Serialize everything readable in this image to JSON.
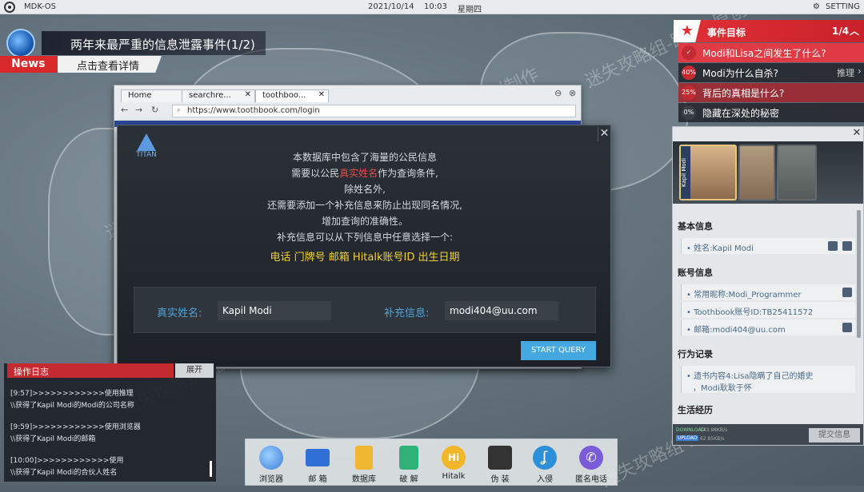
{
  "topbar": {
    "os_name": "MDK-OS",
    "date": "2021/10/14",
    "time": "10:03",
    "weekday": "星期四",
    "setting": "SETTING"
  },
  "news": {
    "title": "两年来最严重的信息泄露事件(1/2)",
    "label": "News",
    "subtitle": "点击查看详情"
  },
  "tasks": {
    "header": "事件目标",
    "count": "1/4",
    "items": [
      {
        "icon": "✓",
        "text": "Modi和Lisa之间发生了什么?",
        "highlight": true
      },
      {
        "icon": "40%",
        "text": "Modi为什么自杀?",
        "action": "推理"
      },
      {
        "icon": "25%",
        "text": "背后的真相是什么?",
        "highlight": false
      },
      {
        "icon": "0%",
        "text": "隐藏在深处的秘密"
      }
    ]
  },
  "info": {
    "portrait_name": "Kapil Modi",
    "sections": {
      "basic": "基本信息",
      "account": "账号信息",
      "behavior": "行为记录",
      "life": "生活经历"
    },
    "basic_items": [
      "姓名:Kapil Modi"
    ],
    "account_items": [
      "常用昵称:Modi_Programmer",
      "Toothbook账号ID:TB25411572",
      "邮箱:modi404@uu.com"
    ],
    "behavior_items": [
      "遗书内容4:Lisa隐瞒了自己的婚史",
      "，Modi耿耿于怀"
    ],
    "footer": {
      "download": "DOWNLOAD",
      "download_rate": "143.98KB/s",
      "upload": "UPLOAD",
      "upload_rate": "62.85KB/s",
      "submit": "提交信息"
    }
  },
  "browser": {
    "tabs": [
      "Home",
      "searchre...",
      "toothboo..."
    ],
    "url": "https://www.toothbook.com/login"
  },
  "modal": {
    "logo": "TITAN",
    "lines": [
      "本数据库中包含了海量的公民信息",
      "需要以公民",
      "真实姓名",
      "作为查询条件,",
      "除姓名外,",
      "还需要添加一个补充信息来防止出现同名情况,",
      "增加查询的准确性。",
      "补充信息可以从下列信息中任意选择一个:"
    ],
    "options": "电话  门牌号  邮箱  Hitalk账号ID  出生日期",
    "name_label": "真实姓名:",
    "name_value": "Kapil Modi",
    "extra_label": "补充信息:",
    "extra_value": "modi404@uu.com",
    "start": "START QUERY"
  },
  "log": {
    "header": "操作日志",
    "expand": "展开",
    "entries": [
      "[9:57]>>>>>>>>>>>>使用推理",
      "\\\\获得了Kapil Modi的Modi的公司名称",
      "[9:59]>>>>>>>>>>>>使用浏览器",
      "\\\\获得了Kapil Modi的邮箱",
      "[10:00]>>>>>>>>>>>>使用",
      "\\\\获得了Kapil Modi的合伙人姓名"
    ]
  },
  "dock": [
    {
      "label": "浏览器",
      "icon": "globe-icon",
      "color": "#3d7fd9"
    },
    {
      "label": "邮 箱",
      "icon": "mail-icon",
      "color": "#2f6fd6"
    },
    {
      "label": "数据库",
      "icon": "database-icon",
      "color": "#f0b733"
    },
    {
      "label": "破 解",
      "icon": "crack-icon",
      "color": "#2fb17a"
    },
    {
      "label": "Hitalk",
      "icon": "hitalk-icon",
      "color": "#f2b62a"
    },
    {
      "label": "伪 装",
      "icon": "disguise-icon",
      "color": "#333333"
    },
    {
      "label": "入侵",
      "icon": "hook-icon",
      "color": "#2d8fd8"
    },
    {
      "label": "匿名电话",
      "icon": "phone-icon",
      "color": "#7a5bd8"
    }
  ],
  "watermark": "迷失攻略组-路人a原创制作"
}
